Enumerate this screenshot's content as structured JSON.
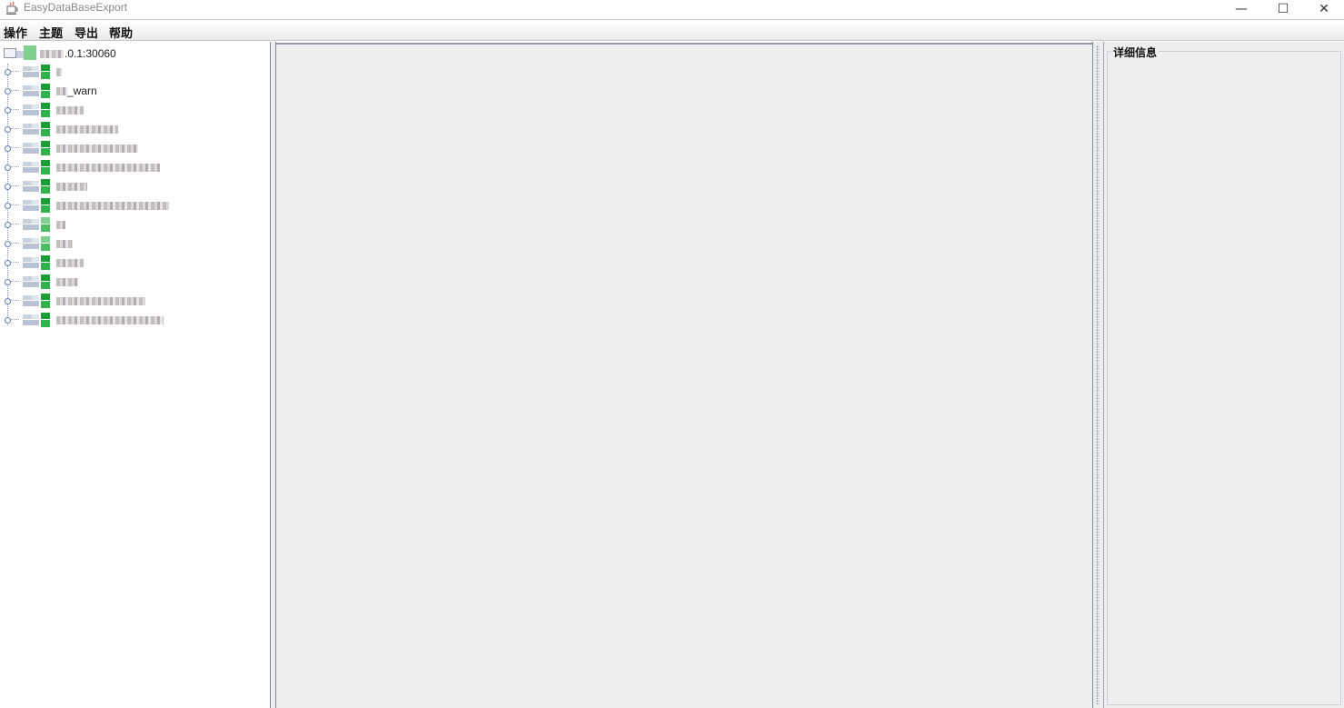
{
  "window": {
    "title": "EasyDataBaseExport",
    "icon": "java-cup-icon",
    "controls": {
      "minimize": "—",
      "maximize": "☐",
      "close": "✕"
    }
  },
  "menubar": {
    "items": [
      "操作",
      "主题",
      "导出",
      "帮助"
    ]
  },
  "tree": {
    "root": {
      "label": ".0.1:30060",
      "icon": "server-connection-icon"
    },
    "nodes": [
      {
        "label": "",
        "blur_width": 6,
        "icon": "database-icon"
      },
      {
        "label": "_warn",
        "blur_width": 12,
        "icon": "database-icon"
      },
      {
        "label": "",
        "blur_width": 30,
        "icon": "database-icon"
      },
      {
        "label": "",
        "blur_width": 68,
        "icon": "database-icon"
      },
      {
        "label": "",
        "blur_width": 90,
        "icon": "database-icon"
      },
      {
        "label": "",
        "blur_width": 114,
        "icon": "database-icon"
      },
      {
        "label": "",
        "blur_width": 34,
        "icon": "database-icon"
      },
      {
        "label": "",
        "blur_width": 124,
        "icon": "database-icon"
      },
      {
        "label": "",
        "blur_width": 10,
        "icon": "database-icon"
      },
      {
        "label": "",
        "blur_width": 18,
        "icon": "database-icon"
      },
      {
        "label": "",
        "blur_width": 30,
        "icon": "database-icon"
      },
      {
        "label": "",
        "blur_width": 24,
        "icon": "database-icon"
      },
      {
        "label": "",
        "blur_width": 98,
        "icon": "database-icon"
      },
      {
        "label": "",
        "blur_width": 118,
        "icon": "database-icon"
      }
    ]
  },
  "details": {
    "title": "详细信息"
  }
}
